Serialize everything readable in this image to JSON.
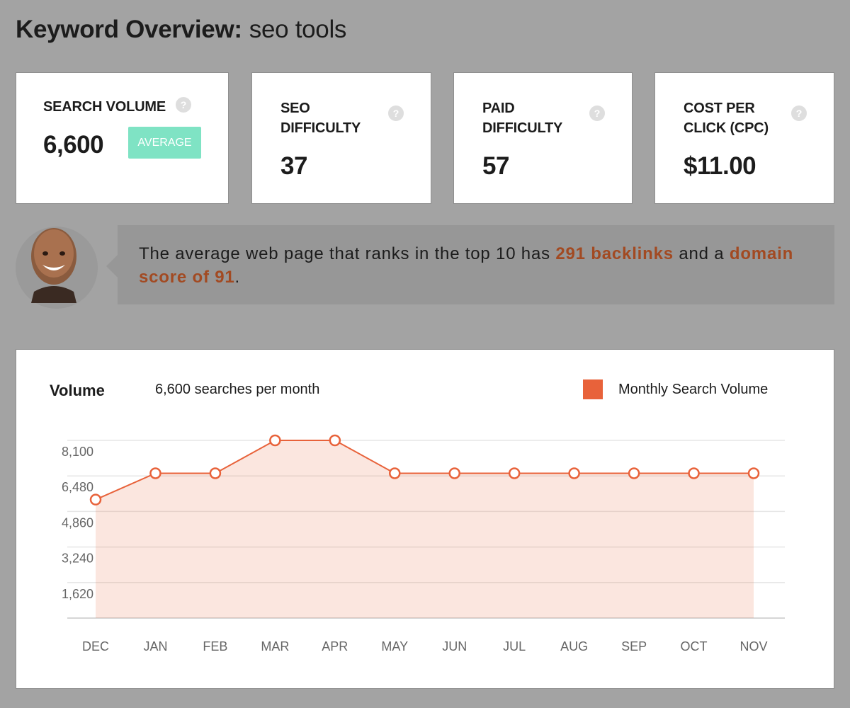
{
  "header": {
    "title_label": "Keyword Overview:",
    "keyword": "seo tools"
  },
  "metrics": [
    {
      "label": "SEARCH VOLUME",
      "value": "6,600",
      "badge": "AVERAGE",
      "help": "?"
    },
    {
      "label": "SEO DIFFICULTY",
      "value": "37",
      "help": "?"
    },
    {
      "label": "PAID DIFFICULTY",
      "value": "57",
      "help": "?"
    },
    {
      "label": "COST PER CLICK (CPC)",
      "value": "$11.00",
      "help": "?"
    }
  ],
  "insight": {
    "text_before": "The average web page that ranks in the top 10 has ",
    "backlinks": "291 backlinks",
    "text_middle": " and a ",
    "domain_score": "domain score of 91",
    "text_after": "."
  },
  "volume_panel": {
    "label": "Volume",
    "summary": "6,600 searches per month",
    "legend": "Monthly Search Volume"
  },
  "colors": {
    "accent": "#e8623a",
    "badge": "#7fe3c4",
    "highlight": "#a24a22"
  },
  "chart_data": {
    "type": "area",
    "categories": [
      "DEC",
      "JAN",
      "FEB",
      "MAR",
      "APR",
      "MAY",
      "JUN",
      "JUL",
      "AUG",
      "SEP",
      "OCT",
      "NOV"
    ],
    "series": [
      {
        "name": "Monthly Search Volume",
        "values": [
          5400,
          6600,
          6600,
          8100,
          8100,
          6600,
          6600,
          6600,
          6600,
          6600,
          6600,
          6600
        ]
      }
    ],
    "y_ticks": [
      "1,620",
      "3,240",
      "4,860",
      "6,480",
      "8,100"
    ],
    "y_tick_values": [
      1620,
      3240,
      4860,
      6480,
      8100
    ],
    "ylim": [
      0,
      8100
    ],
    "grid": true
  }
}
